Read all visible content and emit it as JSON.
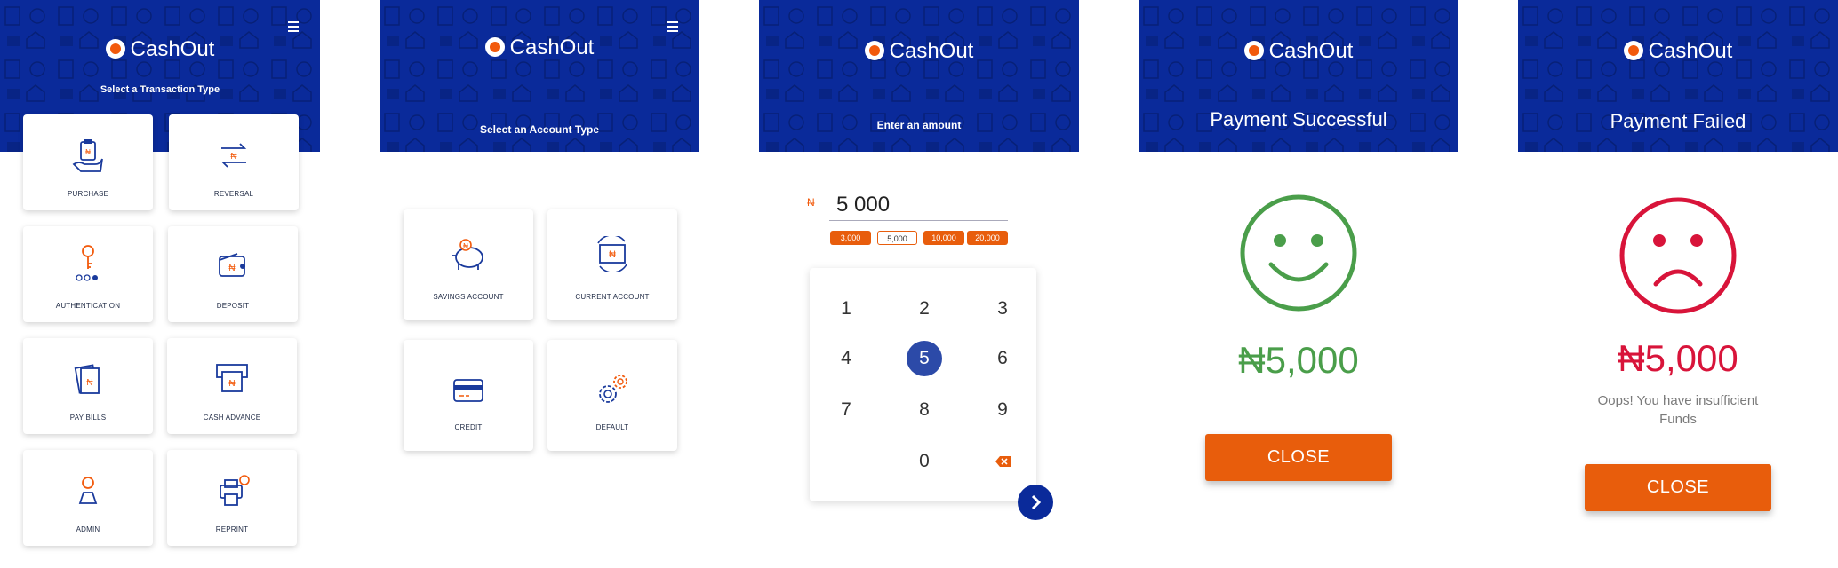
{
  "app": {
    "name": "CashOut"
  },
  "colors": {
    "header": "#0a2a9a",
    "accent": "#e85d0c",
    "success": "#4a9e4a",
    "error": "#d8143a"
  },
  "screen1": {
    "subtitle": "Select a Transaction Type",
    "items": [
      {
        "label": "PURCHASE",
        "icon": "purchase-icon"
      },
      {
        "label": "REVERSAL",
        "icon": "reversal-icon"
      },
      {
        "label": "AUTHENTICATION",
        "icon": "authentication-icon"
      },
      {
        "label": "DEPOSIT",
        "icon": "deposit-icon"
      },
      {
        "label": "PAY BILLS",
        "icon": "pay-bills-icon"
      },
      {
        "label": "CASH ADVANCE",
        "icon": "cash-advance-icon"
      },
      {
        "label": "ADMIN",
        "icon": "admin-icon"
      },
      {
        "label": "REPRINT",
        "icon": "reprint-icon"
      }
    ]
  },
  "screen2": {
    "subtitle": "Select an Account Type",
    "items": [
      {
        "label": "SAVINGS ACCOUNT",
        "icon": "piggy-bank-icon"
      },
      {
        "label": "CURRENT ACCOUNT",
        "icon": "current-account-icon"
      },
      {
        "label": "CREDIT",
        "icon": "credit-card-icon"
      },
      {
        "label": "DEFAULT",
        "icon": "gear-icon"
      }
    ]
  },
  "screen3": {
    "subtitle": "Enter an amount",
    "currency": "₦",
    "amount": "5 000",
    "presets": [
      "3,000",
      "5,000",
      "10,000",
      "20,000"
    ],
    "selected_preset": "5,000",
    "keys": [
      "1",
      "2",
      "3",
      "4",
      "5",
      "6",
      "7",
      "8",
      "9",
      "0"
    ],
    "selected_key": "5"
  },
  "screen4": {
    "title": "Payment Successful",
    "amount": "₦5,000",
    "button": "CLOSE"
  },
  "screen5": {
    "title": "Payment Failed",
    "amount": "₦5,000",
    "message_line1": "Oops! You have insufficient",
    "message_line2": "Funds",
    "button": "CLOSE"
  }
}
